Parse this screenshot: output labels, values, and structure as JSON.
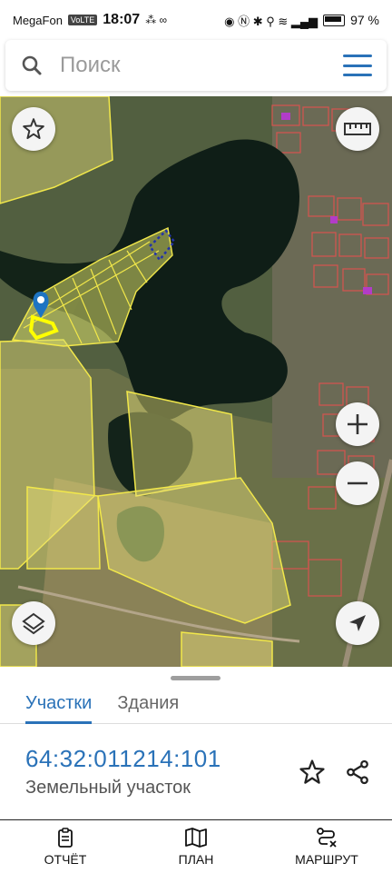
{
  "status_bar": {
    "carrier": "MegaFon",
    "carrier_tag": "VoLTE",
    "time": "18:07",
    "battery": "97 %"
  },
  "search": {
    "placeholder": "Поиск"
  },
  "map": {
    "controls": [
      "favorite-star-icon",
      "ruler-icon",
      "zoom-in-icon",
      "zoom-out-icon",
      "layers-icon",
      "locate-arrow-icon"
    ],
    "accent_color": "#f2e84a",
    "selected_color": "#ffff00"
  },
  "sheet": {
    "tabs": [
      {
        "label": "Участки",
        "active": true
      },
      {
        "label": "Здания",
        "active": false
      }
    ],
    "parcel_id": "64:32:011214:101",
    "parcel_type": "Земельный участок"
  },
  "bottom_nav": {
    "items": [
      {
        "label": "ОТЧЁТ",
        "icon": "report-icon"
      },
      {
        "label": "ПЛАН",
        "icon": "map-plan-icon"
      },
      {
        "label": "МАРШРУТ",
        "icon": "route-icon"
      }
    ]
  },
  "colors": {
    "brand": "#2a72b8",
    "parcel_fill": "#d8dc6a",
    "water": "#0f1e17"
  }
}
